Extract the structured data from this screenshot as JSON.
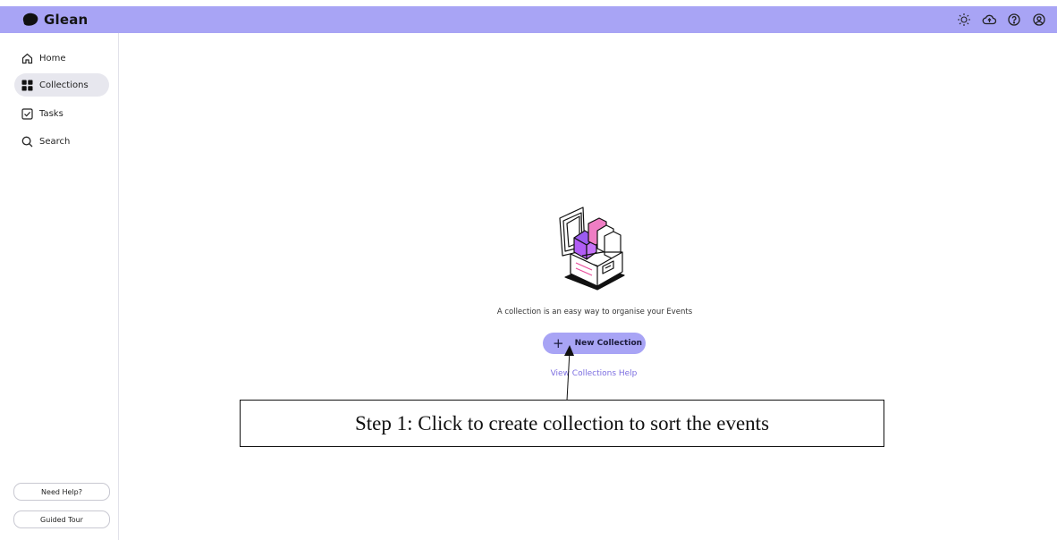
{
  "app": {
    "name": "Glean"
  },
  "header": {
    "icons": [
      "sun-icon",
      "cloud-upload-icon",
      "help-circle-icon",
      "user-circle-icon"
    ]
  },
  "sidebar": {
    "items": [
      {
        "label": "Home",
        "icon": "home-icon",
        "active": false
      },
      {
        "label": "Collections",
        "icon": "grid-icon",
        "active": true
      },
      {
        "label": "Tasks",
        "icon": "checkbox-icon",
        "active": false
      },
      {
        "label": "Search",
        "icon": "search-icon",
        "active": false
      }
    ],
    "need_help": "Need Help?",
    "guided_tour": "Guided Tour"
  },
  "main": {
    "empty_message": "A collection is an easy way to organise your Events",
    "new_collection_label": "New Collection",
    "help_link": "View Collections Help"
  },
  "annotation": {
    "text": "Step 1: Click to create collection to sort the events"
  },
  "colors": {
    "accent": "#a8a4f5",
    "link": "#7b6de0",
    "active_nav": "#e7e7ee"
  }
}
